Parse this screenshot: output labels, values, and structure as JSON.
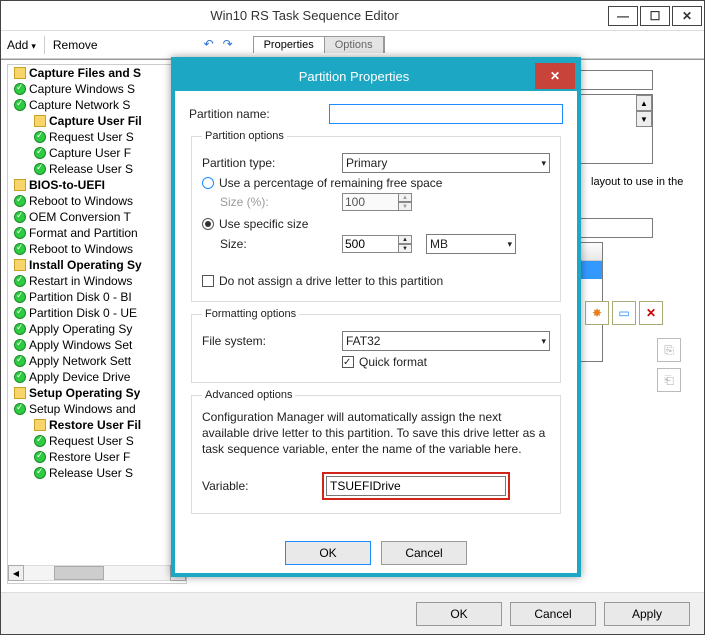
{
  "outer_window": {
    "title": "Win10 RS Task Sequence Editor",
    "toolbar": {
      "add_label": "Add",
      "remove_label": "Remove",
      "tab_properties": "Properties",
      "tab_options": "Options"
    },
    "tree": [
      {
        "type": "group",
        "label": "Capture Files and S"
      },
      {
        "type": "step",
        "label": "Capture Windows S"
      },
      {
        "type": "step",
        "label": "Capture Network S"
      },
      {
        "type": "group",
        "label": "Capture User Fil",
        "indent": 1
      },
      {
        "type": "step",
        "label": "Request User S",
        "indent": 1
      },
      {
        "type": "step",
        "label": "Capture User F",
        "indent": 1
      },
      {
        "type": "step",
        "label": "Release User S",
        "indent": 1
      },
      {
        "type": "group",
        "label": "BIOS-to-UEFI"
      },
      {
        "type": "step",
        "label": "Reboot to Windows"
      },
      {
        "type": "step",
        "label": "OEM Conversion T"
      },
      {
        "type": "step",
        "label": "Format and Partition"
      },
      {
        "type": "step",
        "label": "Reboot to Windows"
      },
      {
        "type": "group",
        "label": "Install Operating Sy"
      },
      {
        "type": "step",
        "label": "Restart in Windows"
      },
      {
        "type": "step",
        "label": "Partition Disk 0 - BI"
      },
      {
        "type": "step",
        "label": "Partition Disk 0 - UE"
      },
      {
        "type": "step",
        "label": "Apply Operating Sy"
      },
      {
        "type": "step",
        "label": "Apply Windows Set"
      },
      {
        "type": "step",
        "label": "Apply Network Sett"
      },
      {
        "type": "step",
        "label": "Apply Device Drive"
      },
      {
        "type": "group",
        "label": "Setup Operating Sy"
      },
      {
        "type": "step",
        "label": "Setup Windows and"
      },
      {
        "type": "group",
        "label": "Restore User Fil",
        "indent": 1
      },
      {
        "type": "step",
        "label": "Request User S",
        "indent": 1
      },
      {
        "type": "step",
        "label": "Restore User F",
        "indent": 1
      },
      {
        "type": "step",
        "label": "Release User S",
        "indent": 1
      }
    ],
    "right_panel": {
      "hint": "layout to use in the"
    },
    "footer": {
      "ok": "OK",
      "cancel": "Cancel",
      "apply": "Apply"
    }
  },
  "modal": {
    "title": "Partition Properties",
    "partition_name_label": "Partition name:",
    "partition_name_value": "",
    "options_legend": "Partition options",
    "partition_type_label": "Partition type:",
    "partition_type_value": "Primary",
    "use_percent_label": "Use a percentage of remaining free space",
    "size_percent_label": "Size (%):",
    "size_percent_value": "100",
    "use_specific_label": "Use specific size",
    "size_label": "Size:",
    "size_value": "500",
    "size_unit": "MB",
    "no_letter_label": "Do not assign a drive letter to this partition",
    "format_legend": "Formatting options",
    "fs_label": "File system:",
    "fs_value": "FAT32",
    "quick_format_label": "Quick format",
    "advanced_legend": "Advanced options",
    "advanced_text": "Configuration Manager will automatically assign the next available drive letter to this partition. To save this drive letter as a task sequence variable, enter the name of the variable here.",
    "variable_label": "Variable:",
    "variable_value": "TSUEFIDrive",
    "ok": "OK",
    "cancel": "Cancel"
  }
}
